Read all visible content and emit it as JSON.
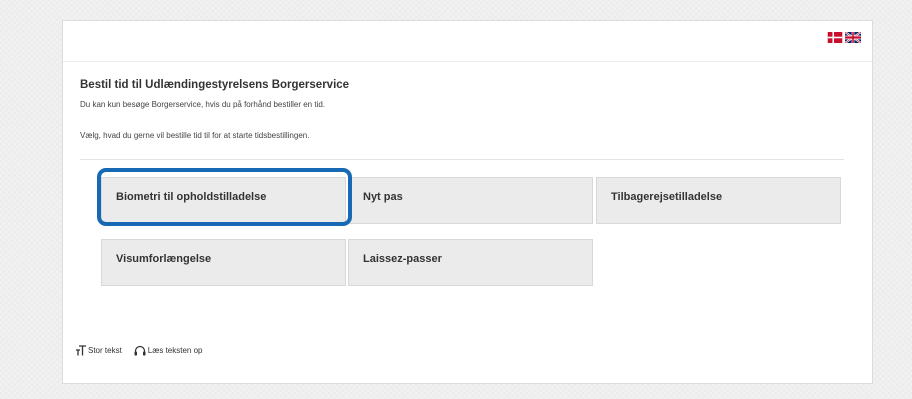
{
  "header": {
    "language_options": [
      {
        "code": "da",
        "icon": "danish-flag-icon"
      },
      {
        "code": "en",
        "icon": "uk-flag-icon"
      }
    ]
  },
  "main": {
    "title": "Bestil tid til Udlændingestyrelsens Borgerservice",
    "intro": "Du kan kun besøge Borgerservice, hvis du på forhånd bestiller en tid.",
    "instruction": "Vælg, hvad du gerne vil bestille tid til for at starte tidsbestillingen.",
    "options": [
      {
        "label": "Biometri til opholdstilladelse",
        "highlighted": true
      },
      {
        "label": "Nyt pas"
      },
      {
        "label": "Tilbagerejsetilladelse"
      },
      {
        "label": "Visumforlængelse"
      },
      {
        "label": "Laissez-passer"
      }
    ]
  },
  "footer": {
    "large_text": "Stor tekst",
    "read_aloud": "Læs teksten op"
  },
  "colors": {
    "highlight": "#1869b3",
    "button_bg": "#ebebeb",
    "danish_red": "#c8102e",
    "uk_blue": "#012169"
  }
}
